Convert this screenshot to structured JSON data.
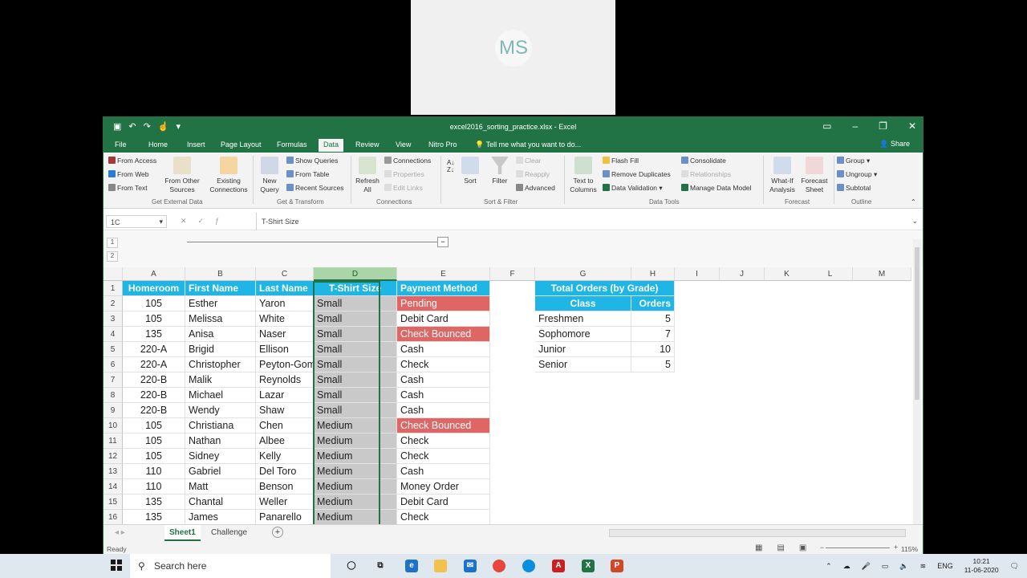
{
  "webcam": {
    "initials": "MS"
  },
  "window": {
    "title": "excel2016_sorting_practice.xlsx - Excel",
    "tabs": [
      "File",
      "Home",
      "Insert",
      "Page Layout",
      "Formulas",
      "Data",
      "Review",
      "View",
      "Nitro Pro"
    ],
    "active_tab": "Data",
    "tell_me": "Tell me what you want to do...",
    "share": "Share"
  },
  "ribbon": {
    "get_external": {
      "from_access": "From Access",
      "from_web": "From Web",
      "from_text": "From Text",
      "from_other": "From Other Sources",
      "existing": "Existing Connections",
      "label": "Get External Data"
    },
    "get_transform": {
      "new_query": "New Query",
      "show_queries": "Show Queries",
      "from_table": "From Table",
      "recent": "Recent Sources",
      "label": "Get & Transform"
    },
    "connections": {
      "refresh": "Refresh All",
      "connections": "Connections",
      "properties": "Properties",
      "edit_links": "Edit Links",
      "label": "Connections"
    },
    "sort_filter": {
      "sort": "Sort",
      "filter": "Filter",
      "clear": "Clear",
      "reapply": "Reapply",
      "advanced": "Advanced",
      "label": "Sort & Filter"
    },
    "data_tools": {
      "text_to_columns": "Text to Columns",
      "flash_fill": "Flash Fill",
      "remove_dup": "Remove Duplicates",
      "validation": "Data Validation",
      "consolidate": "Consolidate",
      "relationships": "Relationships",
      "manage_model": "Manage Data Model",
      "label": "Data Tools"
    },
    "forecast": {
      "what_if": "What-If Analysis",
      "forecast_sheet": "Forecast Sheet",
      "label": "Forecast"
    },
    "outline": {
      "group": "Group",
      "ungroup": "Ungroup",
      "subtotal": "Subtotal",
      "label": "Outline"
    }
  },
  "formula_bar": {
    "name_box": "1C",
    "formula": "T-Shirt Size"
  },
  "outline_levels": [
    "1",
    "2"
  ],
  "columns": [
    "A",
    "B",
    "C",
    "D",
    "E",
    "F",
    "G",
    "H",
    "I",
    "J",
    "K",
    "L",
    "M"
  ],
  "headers": {
    "a": "Homeroom",
    "b": "First Name",
    "c": "Last Name",
    "d": "T-Shirt Size",
    "e": "Payment Method"
  },
  "rows": [
    {
      "n": "2",
      "a": "105",
      "b": "Esther",
      "c": "Yaron",
      "d": "Small",
      "e": "Pending",
      "red": true
    },
    {
      "n": "3",
      "a": "105",
      "b": "Melissa",
      "c": "White",
      "d": "Small",
      "e": "Debit Card",
      "red": false
    },
    {
      "n": "4",
      "a": "135",
      "b": "Anisa",
      "c": "Naser",
      "d": "Small",
      "e": "Check Bounced",
      "red": true
    },
    {
      "n": "5",
      "a": "220-A",
      "b": "Brigid",
      "c": "Ellison",
      "d": "Small",
      "e": "Cash",
      "red": false
    },
    {
      "n": "6",
      "a": "220-A",
      "b": "Christopher",
      "c": "Peyton-Gomez",
      "d": "Small",
      "e": "Check",
      "red": false
    },
    {
      "n": "7",
      "a": "220-B",
      "b": "Malik",
      "c": "Reynolds",
      "d": "Small",
      "e": "Cash",
      "red": false
    },
    {
      "n": "8",
      "a": "220-B",
      "b": "Michael",
      "c": "Lazar",
      "d": "Small",
      "e": "Cash",
      "red": false
    },
    {
      "n": "9",
      "a": "220-B",
      "b": "Wendy",
      "c": "Shaw",
      "d": "Small",
      "e": "Cash",
      "red": false
    },
    {
      "n": "10",
      "a": "105",
      "b": "Christiana",
      "c": "Chen",
      "d": "Medium",
      "e": "Check Bounced",
      "red": true
    },
    {
      "n": "11",
      "a": "105",
      "b": "Nathan",
      "c": "Albee",
      "d": "Medium",
      "e": "Check",
      "red": false
    },
    {
      "n": "12",
      "a": "105",
      "b": "Sidney",
      "c": "Kelly",
      "d": "Medium",
      "e": "Check",
      "red": false
    },
    {
      "n": "13",
      "a": "110",
      "b": "Gabriel",
      "c": "Del Toro",
      "d": "Medium",
      "e": "Cash",
      "red": false
    },
    {
      "n": "14",
      "a": "110",
      "b": "Matt",
      "c": "Benson",
      "d": "Medium",
      "e": "Money Order",
      "red": false
    },
    {
      "n": "15",
      "a": "135",
      "b": "Chantal",
      "c": "Weller",
      "d": "Medium",
      "e": "Debit Card",
      "red": false
    },
    {
      "n": "16",
      "a": "135",
      "b": "James",
      "c": "Panarello",
      "d": "Medium",
      "e": "Check",
      "red": false
    }
  ],
  "summary": {
    "title": "Total Orders (by Grade)",
    "col_class": "Class",
    "col_orders": "Orders",
    "items": [
      {
        "class": "Freshmen",
        "orders": "5"
      },
      {
        "class": "Sophomore",
        "orders": "7"
      },
      {
        "class": "Junior",
        "orders": "10"
      },
      {
        "class": "Senior",
        "orders": "5"
      }
    ]
  },
  "sheets": [
    "Sheet1",
    "Challenge"
  ],
  "active_sheet": "Sheet1",
  "status": {
    "ready": "Ready",
    "zoom": "115%"
  },
  "taskbar": {
    "search": "Search here",
    "lang": "ENG",
    "time": "10:21",
    "date": "11-06-2020"
  },
  "colors": {
    "excel_green": "#217346",
    "header_blue": "#1fb6e6",
    "alert_red": "#e06666",
    "selection_grey": "#c9c9c9"
  }
}
